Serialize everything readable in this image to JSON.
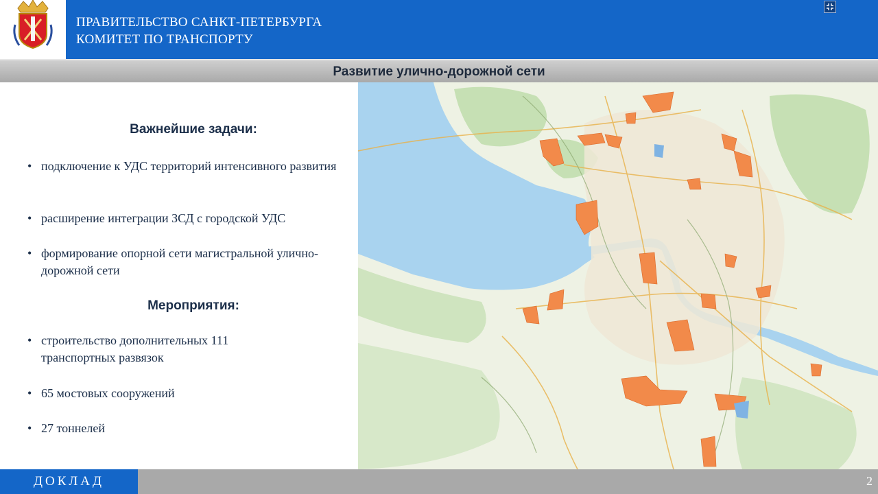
{
  "header": {
    "org_line1": "ПРАВИТЕЛЬСТВО САНКТ-ПЕТЕРБУРГА",
    "org_line2": "КОМИТЕТ ПО ТРАНСПОРТУ",
    "logo_icon": "saint-petersburg-coat-of-arms",
    "fullscreen_icon": "fullscreen-exit-icon",
    "background_color": "#1466c8"
  },
  "slide": {
    "title": "Развитие улично-дорожной сети"
  },
  "tasks": {
    "heading": "Важнейшие задачи:",
    "items": [
      "подключение к УДС территорий интенсивного развития",
      "расширение интеграции ЗСД с городской УДС",
      "формирование опорной сети магистральной улично-дорожной сети"
    ]
  },
  "measures": {
    "heading": "Мероприятия:",
    "items": [
      "строительство дополнительных 111 транспортных развязок",
      "65 мостовых сооружений",
      "27 тоннелей"
    ]
  },
  "map": {
    "water_color": "#a9d3ef",
    "land_color": "#eef2e4",
    "green_color": "#c6e0b4",
    "highlight_color": "#f28a4a"
  },
  "footer": {
    "label": "ДОКЛАД",
    "page_number": "2"
  }
}
